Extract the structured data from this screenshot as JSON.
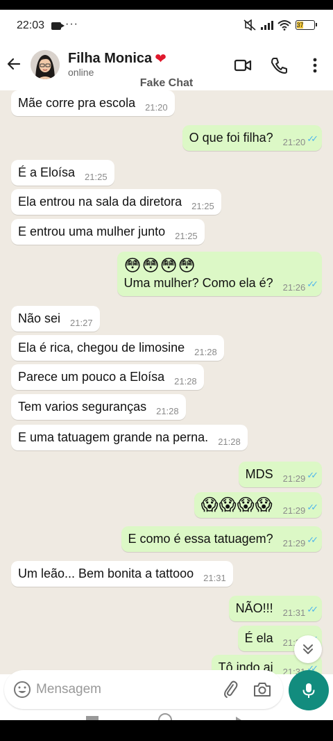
{
  "status_bar": {
    "time": "22:03",
    "dots": "···",
    "battery": "37"
  },
  "header": {
    "name": "Filha Monica",
    "heart": "❤",
    "presence": "online",
    "watermark": "Fake Chat"
  },
  "messages": [
    {
      "dir": "in",
      "text": "Mãe corre pra escola",
      "time": "21:20"
    },
    {
      "dir": "out",
      "text": "O que foi filha?",
      "time": "21:20",
      "read": true
    },
    {
      "dir": "in",
      "text": "É a Eloísa",
      "time": "21:25"
    },
    {
      "dir": "in",
      "text": "Ela entrou na sala da diretora",
      "time": "21:25"
    },
    {
      "dir": "in",
      "text": "E entrou uma mulher junto",
      "time": "21:25"
    },
    {
      "dir": "out",
      "emoji": "😳😳😳😳",
      "text": "Uma mulher? Como ela é?",
      "time": "21:26",
      "read": true
    },
    {
      "dir": "in",
      "text": "Não sei",
      "time": "21:27"
    },
    {
      "dir": "in",
      "text": "Ela é rica, chegou de limosine",
      "time": "21:28"
    },
    {
      "dir": "in",
      "text": "Parece um pouco a Eloísa",
      "time": "21:28"
    },
    {
      "dir": "in",
      "text": "Tem varios seguranças",
      "time": "21:28"
    },
    {
      "dir": "in",
      "text": "E uma tatuagem grande na perna.",
      "time": "21:28"
    },
    {
      "dir": "out",
      "text": "MDS",
      "time": "21:29",
      "read": true
    },
    {
      "dir": "out",
      "text": "😱😱😱😱",
      "time": "21:29",
      "read": true,
      "emoji_only": true
    },
    {
      "dir": "out",
      "text": "E como é essa tatuagem?",
      "time": "21:29",
      "read": true
    },
    {
      "dir": "in",
      "text": "Um leão... Bem bonita a tattooo",
      "time": "21:31"
    },
    {
      "dir": "out",
      "text": "NÃO!!!",
      "time": "21:31",
      "read": true
    },
    {
      "dir": "out",
      "text": "É ela",
      "time": "21:31",
      "read": true
    },
    {
      "dir": "out",
      "text": "Tô indo ai",
      "time": "21:31",
      "read": true
    }
  ],
  "composer": {
    "placeholder": "Mensagem"
  },
  "icons": {
    "back": "arrow-left",
    "video": "video-camera",
    "call": "phone",
    "menu": "vertical-dots",
    "emoji": "smiley",
    "attach": "paperclip",
    "camera": "camera",
    "mic": "microphone",
    "scroll": "chevron-double-down"
  },
  "colors": {
    "incoming": "#ffffff",
    "outgoing": "#dcf8c6",
    "chat_bg": "#efeae2",
    "accent": "#128c7e",
    "read_tick": "#4fb6ec"
  }
}
